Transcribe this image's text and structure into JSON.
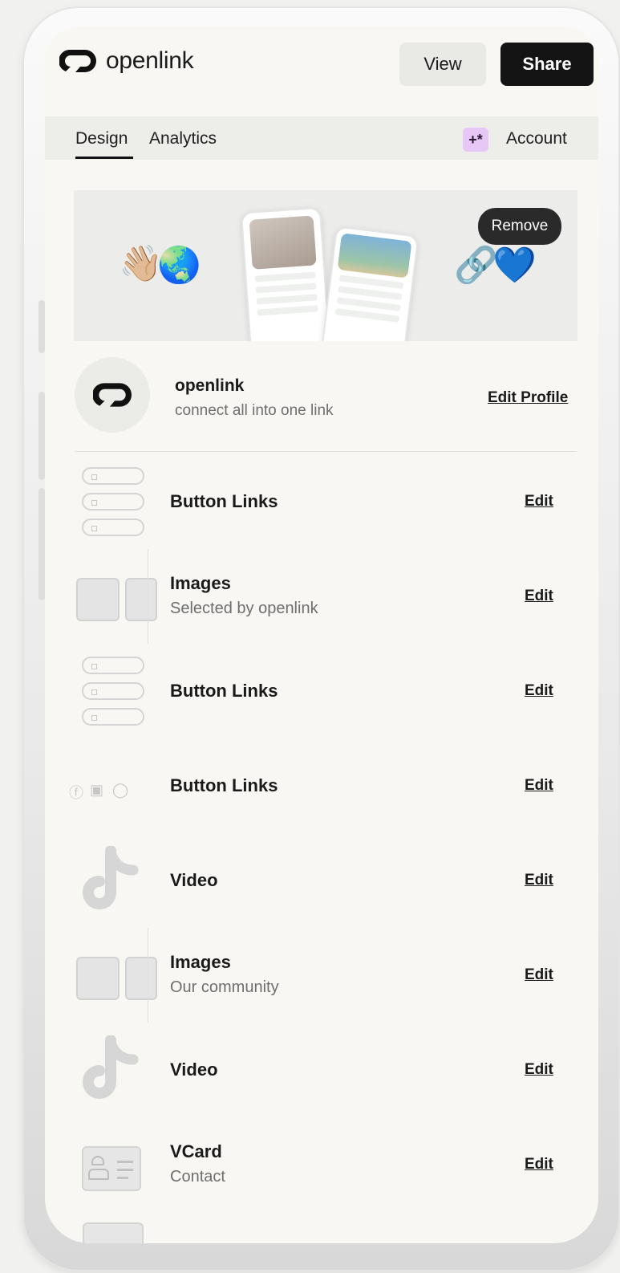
{
  "header": {
    "brand": "openlink",
    "view_label": "View",
    "share_label": "Share"
  },
  "tabs": {
    "design": "Design",
    "analytics": "Analytics",
    "account": "Account",
    "sparkle_glyph": "+*"
  },
  "banner": {
    "emoji_left": [
      "👋🏼",
      "🌏"
    ],
    "emoji_right": [
      "🔗",
      "💙"
    ],
    "remove_label": "Remove"
  },
  "profile": {
    "name": "openlink",
    "tagline": "connect all into one link",
    "edit_label": "Edit Profile"
  },
  "blocks": [
    {
      "type": "button-links",
      "title": "Button Links",
      "subtitle": "",
      "edit": "Edit",
      "icon": "button-links-icon"
    },
    {
      "type": "images",
      "title": "Images",
      "subtitle": "Selected by openlink",
      "edit": "Edit",
      "icon": "images-icon"
    },
    {
      "type": "button-links",
      "title": "Button Links",
      "subtitle": "",
      "edit": "Edit",
      "icon": "button-links-icon"
    },
    {
      "type": "social-links",
      "title": "Button Links",
      "subtitle": "",
      "edit": "Edit",
      "icon": "social-links-icon"
    },
    {
      "type": "video",
      "title": "Video",
      "subtitle": "",
      "edit": "Edit",
      "icon": "tiktok-icon"
    },
    {
      "type": "images",
      "title": "Images",
      "subtitle": "Our community",
      "edit": "Edit",
      "icon": "images-icon"
    },
    {
      "type": "video",
      "title": "Video",
      "subtitle": "",
      "edit": "Edit",
      "icon": "tiktok-icon"
    },
    {
      "type": "vcard",
      "title": "VCard",
      "subtitle": "Contact",
      "edit": "Edit",
      "icon": "vcard-icon"
    }
  ],
  "colors": {
    "accent": "#141414",
    "sparkle_bg": "#e6c7f5",
    "screen_bg": "#f8f7f3"
  }
}
